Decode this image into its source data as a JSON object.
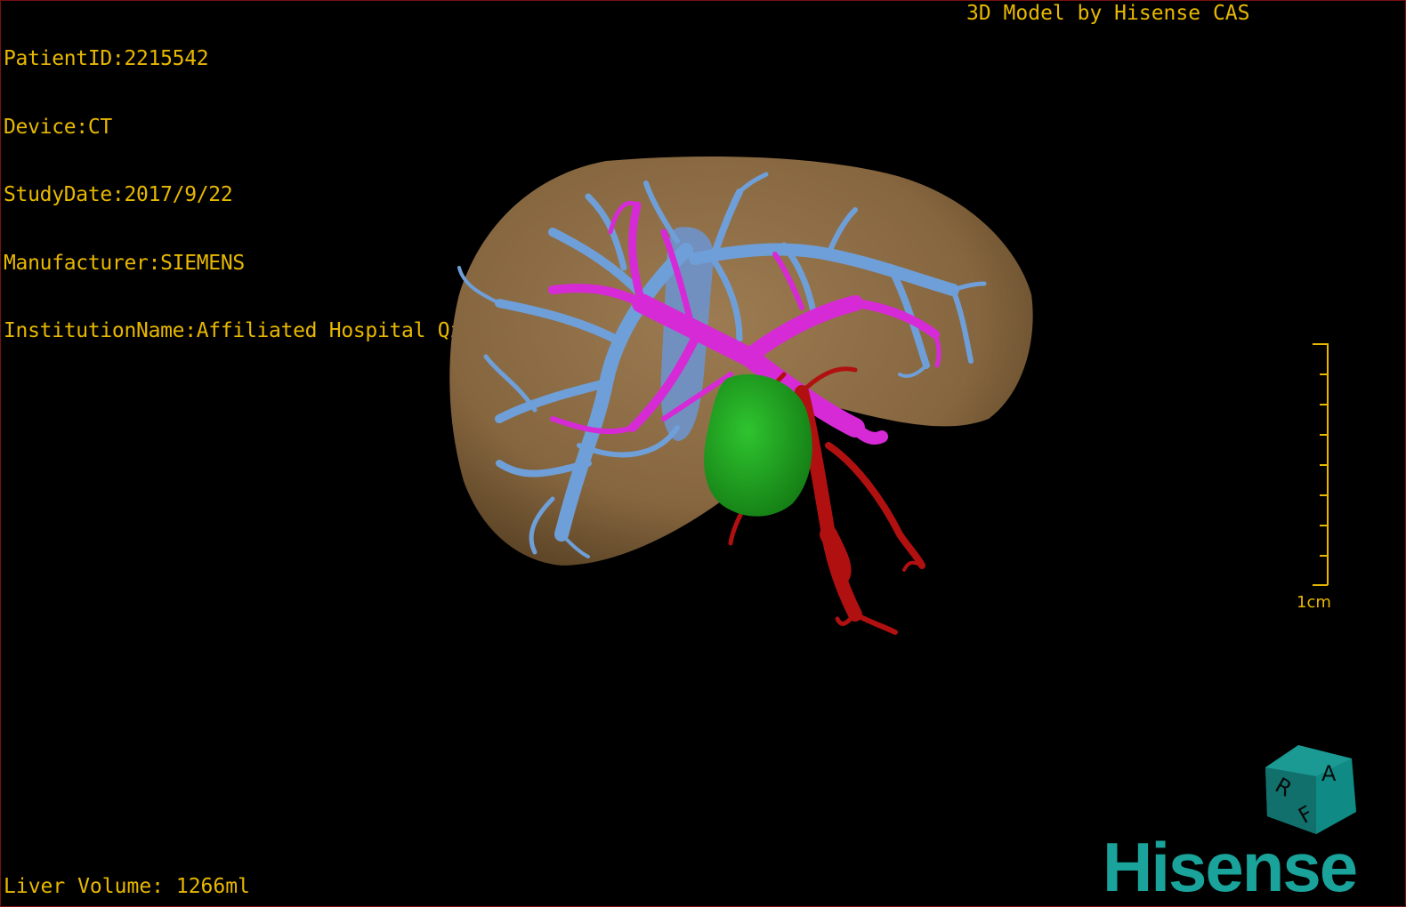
{
  "header": {
    "info_lines": [
      "PatientID:2215542",
      "Device:CT",
      "StudyDate:2017/9/22",
      "Manufacturer:SIEMENS",
      "InstitutionName:Affiliated Hospital Qingdao University-C"
    ],
    "model_credit": "3D Model by Hisense CAS"
  },
  "footer": {
    "liver_volume": "Liver Volume: 1266ml"
  },
  "scale": {
    "label": "1cm",
    "tick_count": 9
  },
  "orientation_cube": {
    "labels": [
      "A",
      "R",
      "F"
    ]
  },
  "brand": {
    "logo_text": "Hisense"
  },
  "colors": {
    "overlay_text": "#e8b800",
    "liver": "#8a6a44",
    "hepatic_vein": "#6f9fd8",
    "portal_vein": "#d62ad6",
    "artery": "#b01010",
    "gallbladder": "#1fa51f",
    "brand": "#1aa39a"
  }
}
